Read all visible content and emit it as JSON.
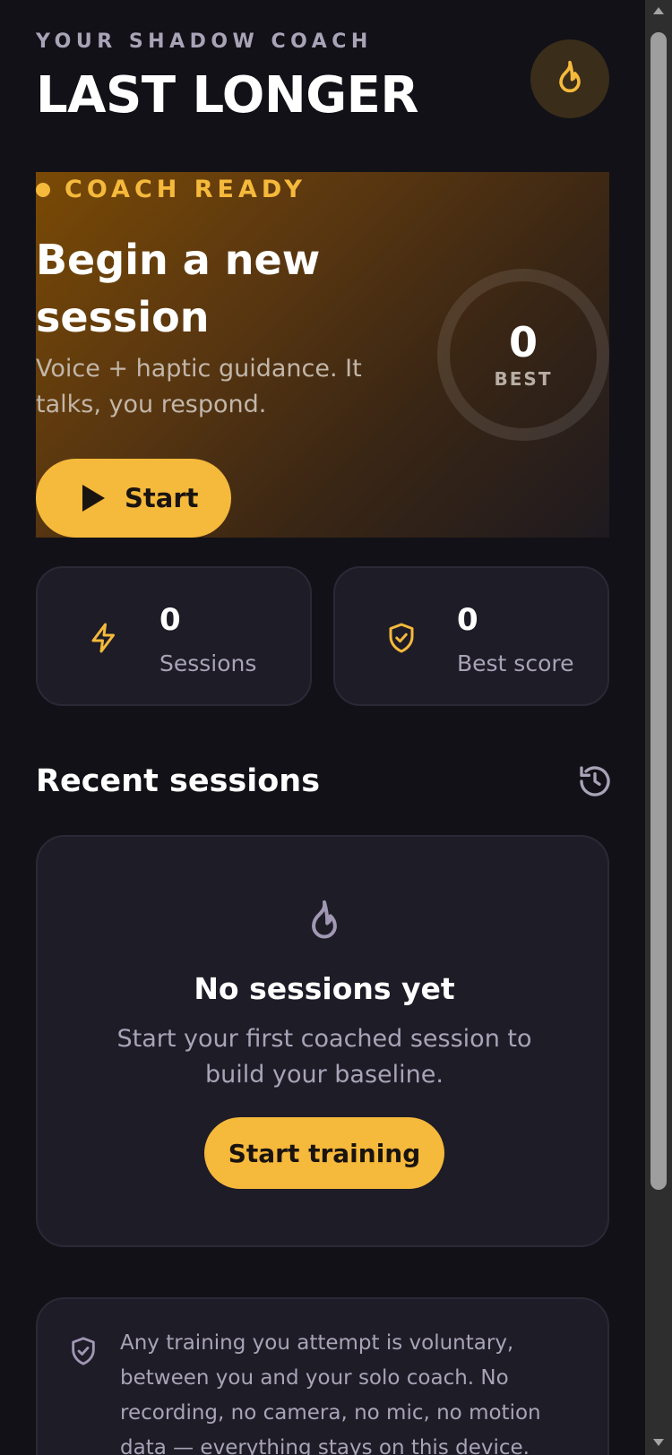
{
  "header": {
    "eyebrow": "YOUR SHADOW COACH",
    "title": "LAST LONGER",
    "profile_icon": "flame-icon"
  },
  "hero": {
    "status": "COACH READY",
    "title": "Begin a new session",
    "subtitle": "Voice + haptic guidance. It talks, you respond.",
    "start_label": "Start",
    "ring_value": "0",
    "ring_label": "BEST"
  },
  "stats": [
    {
      "icon": "lightning-icon",
      "value": "0",
      "label": "Sessions"
    },
    {
      "icon": "shield-check-icon",
      "value": "0",
      "label": "Best score"
    }
  ],
  "recent": {
    "title": "Recent sessions",
    "history_icon": "history-icon",
    "empty_title": "No sessions yet",
    "empty_text": "Start your first coached session to build your baseline.",
    "cta_label": "Start training"
  },
  "privacy": {
    "text": "Any training you attempt is voluntary, between you and your solo coach. No recording, no camera, no mic, no motion data — everything stays on this device. Pause or"
  },
  "colors": {
    "accent": "#f5b93b",
    "background": "#121117",
    "card": "#1e1c27",
    "muted_text": "#a9a3b7"
  }
}
